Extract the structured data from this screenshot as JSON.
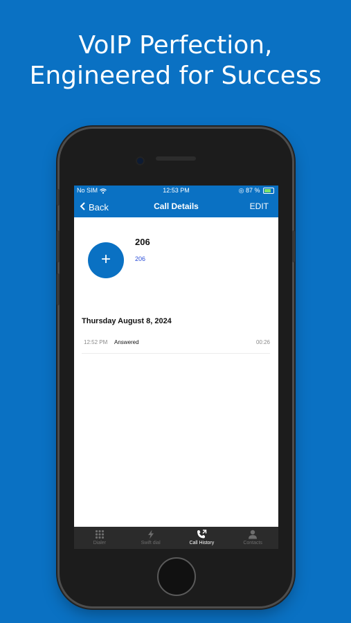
{
  "headline": {
    "line1": "VoIP Perfection,",
    "line2": "Engineered for Success"
  },
  "statusbar": {
    "carrier": "No SIM",
    "time": "12:53 PM",
    "battery": "87 %"
  },
  "navbar": {
    "back_label": "Back",
    "title": "Call Details",
    "edit_label": "EDIT"
  },
  "contact": {
    "add_icon": "+",
    "name": "206",
    "number": "206"
  },
  "history": {
    "date": "Thursday August 8, 2024",
    "calls": [
      {
        "time": "12:52 PM",
        "status": "Answered",
        "duration": "00:26"
      }
    ]
  },
  "tabs": [
    {
      "label": "Dialer",
      "icon": "keypad-icon",
      "active": false
    },
    {
      "label": "Swift dial",
      "icon": "lightning-icon",
      "active": false
    },
    {
      "label": "Call History",
      "icon": "call-history-icon",
      "active": true
    },
    {
      "label": "Contacts",
      "icon": "person-icon",
      "active": false
    }
  ],
  "colors": {
    "brand_blue": "#0a71c3",
    "tabbar_bg": "#2b2b2b",
    "link_blue": "#2b4ed8"
  }
}
